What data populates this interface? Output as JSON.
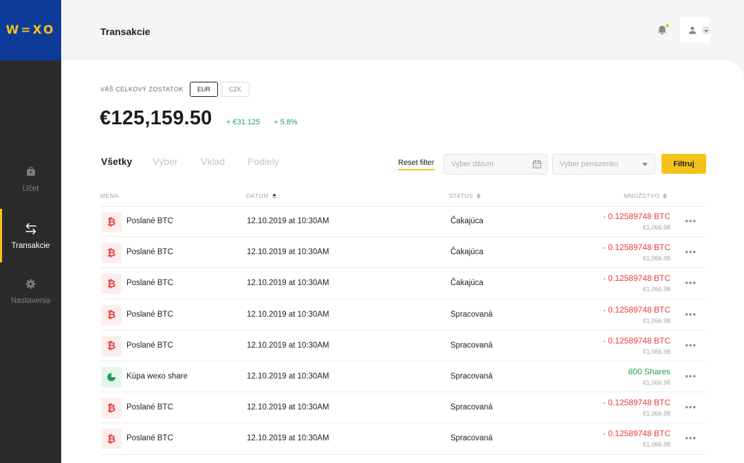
{
  "sidebar": {
    "logo": "W=XO",
    "items": [
      {
        "label": "Účet",
        "icon": "briefcase-icon"
      },
      {
        "label": "Transakcie",
        "icon": "arrows-swap-icon"
      },
      {
        "label": "Nastavenia",
        "icon": "gear-icon"
      }
    ],
    "active_index": 1
  },
  "header": {
    "title": "Transakcie"
  },
  "balance": {
    "label": "VÁŠ CELKOVÝ ZOSTATOK",
    "currencies": [
      "EUR",
      "CZK"
    ],
    "selected_currency": "EUR",
    "amount": "€125,159.50",
    "change_value": "+ €31.125",
    "change_percent": "+ 5.8%"
  },
  "tabs": [
    "Všetky",
    "Výber",
    "Vklad",
    "Podiely"
  ],
  "filters": {
    "reset_label": "Reset filter",
    "date_placeholder": "Vyber dátum",
    "wallet_placeholder": "Vyber penazenku",
    "filter_button": "Filtruj"
  },
  "table": {
    "columns": [
      "MENA",
      "DÁTUM",
      "STATUS",
      "MNOŽSTVO"
    ],
    "rows": [
      {
        "type": "btc",
        "name": "Poslané BTC",
        "date": "12.10.2019 at 10:30AM",
        "status": "Čakajúca",
        "amount": "- 0.12589748 BTC",
        "eur": "€1,066.98"
      },
      {
        "type": "btc",
        "name": "Poslané BTC",
        "date": "12.10.2019 at 10:30AM",
        "status": "Čakajúca",
        "amount": "- 0.12589748 BTC",
        "eur": "€1,066.98"
      },
      {
        "type": "btc",
        "name": "Poslané BTC",
        "date": "12.10.2019 at 10:30AM",
        "status": "Čakajúca",
        "amount": "- 0.12589748 BTC",
        "eur": "€1,066.98"
      },
      {
        "type": "btc",
        "name": "Poslané BTC",
        "date": "12.10.2019 at 10:30AM",
        "status": "Spracovaná",
        "amount": "- 0.12589748 BTC",
        "eur": "€1,066.98"
      },
      {
        "type": "btc",
        "name": "Poslané BTC",
        "date": "12.10.2019 at 10:30AM",
        "status": "Spracovaná",
        "amount": "- 0.12589748 BTC",
        "eur": "€1,066.98"
      },
      {
        "type": "share",
        "name": "Kúpa wexo share",
        "date": "12.10.2019 at 10:30AM",
        "status": "Spracovaná",
        "amount": "800 Shares",
        "eur": "€1,066.98"
      },
      {
        "type": "btc",
        "name": "Poslané BTC",
        "date": "12.10.2019 at 10:30AM",
        "status": "Spracovaná",
        "amount": "- 0.12589748 BTC",
        "eur": "€1,066.98"
      },
      {
        "type": "btc",
        "name": "Poslané BTC",
        "date": "12.10.2019 at 10:30AM",
        "status": "Spracovaná",
        "amount": "- 0.12589748 BTC",
        "eur": "€1,066.98"
      }
    ]
  },
  "colors": {
    "brand_blue": "#0e3a9a",
    "accent_yellow": "#f4c21a",
    "negative_red": "#ec3b3b",
    "positive_green": "#21a05a",
    "sidebar_bg": "#2b2b2b"
  }
}
